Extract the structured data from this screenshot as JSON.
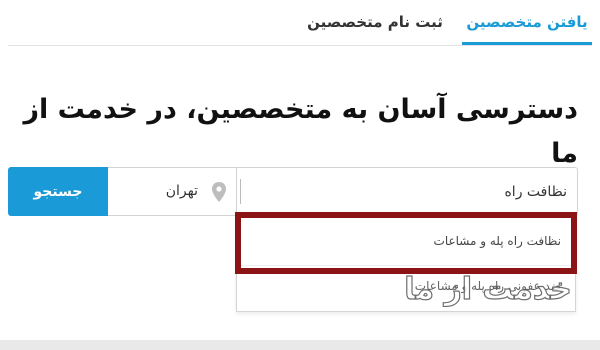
{
  "tabs": {
    "find_experts": "یافتن متخصصین",
    "register_expert": "ثبت نام متخصصین"
  },
  "hero": {
    "title": "دسترسی آسان به متخصصین، در خدمت از ما"
  },
  "search": {
    "service_value": "نظافت راه",
    "location_value": "تهران",
    "button_label": "جستجو"
  },
  "suggestions": [
    "نظافت راه پله و مشاعات",
    "ضد عفونی راه پله و مشاعات"
  ],
  "watermark": "خدمت از ما",
  "colors": {
    "accent": "#1a9ad6",
    "highlight": "#8b1414"
  },
  "icons": {
    "location": "map-pin-icon"
  }
}
